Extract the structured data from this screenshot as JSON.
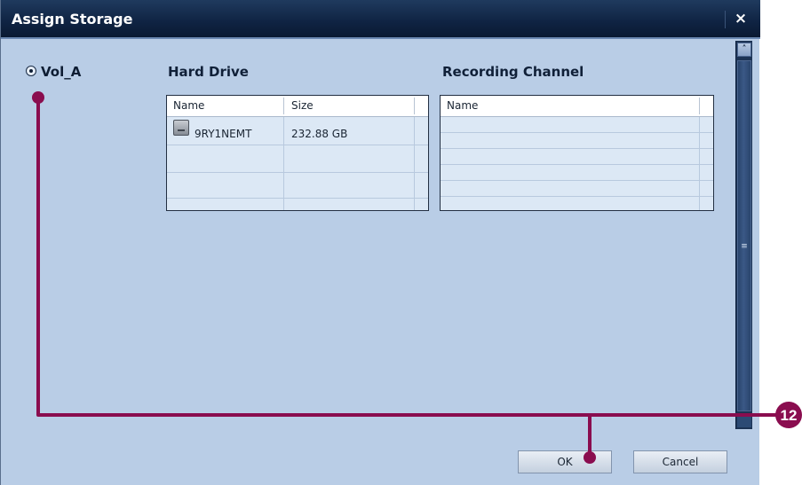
{
  "dialog": {
    "title": "Assign Storage",
    "close_icon": "close-icon",
    "close_glyph": "×"
  },
  "volume": {
    "label": "Vol_A",
    "selected": true
  },
  "hard_drive": {
    "title": "Hard Drive",
    "columns": [
      "Name",
      "Size"
    ],
    "rows": [
      {
        "icon": "hard-disk-icon",
        "name": "9RY1NEMT",
        "size": "232.88 GB"
      }
    ]
  },
  "recording_channel": {
    "title": "Recording Channel",
    "columns": [
      "Name"
    ],
    "rows": []
  },
  "buttons": {
    "ok_label": "OK",
    "cancel_label": "Cancel"
  },
  "scrollbar": {
    "up_glyph": "˄",
    "grip_glyph": "≡"
  },
  "callout": {
    "number": "12",
    "color": "#8a0d4f"
  }
}
